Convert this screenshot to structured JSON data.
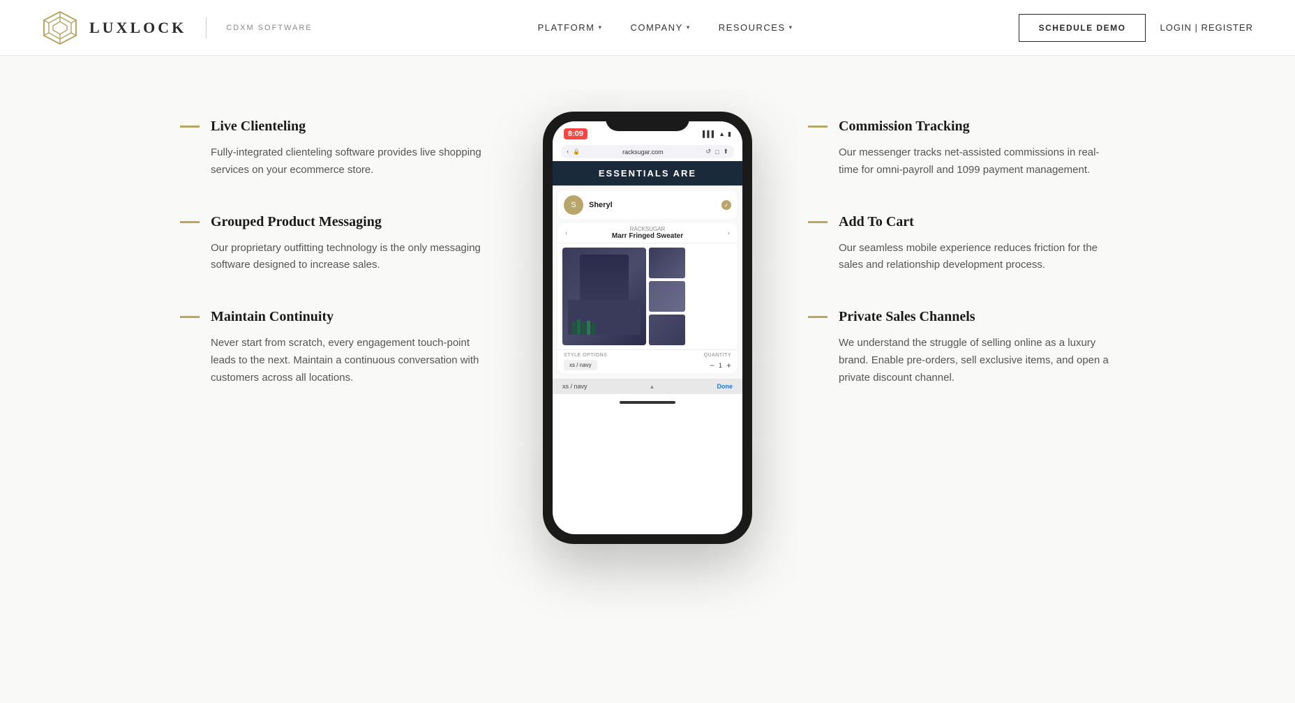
{
  "header": {
    "logo_text": "LUXLOCK",
    "logo_sub": "CDXM SOFTWARE",
    "nav": [
      {
        "label": "PLATFORM",
        "has_dropdown": true
      },
      {
        "label": "COMPANY",
        "has_dropdown": true
      },
      {
        "label": "RESOURCES",
        "has_dropdown": true
      }
    ],
    "schedule_demo": "SCHEDULE DEMO",
    "login": "LOGIN | REGISTER"
  },
  "features_left": [
    {
      "title": "Live Clienteling",
      "desc": "Fully-integrated clienteling software provides live shopping services on your ecommerce store."
    },
    {
      "title": "Grouped Product Messaging",
      "desc": "Our proprietary outfitting technology is the only messaging software designed to increase sales."
    },
    {
      "title": "Maintain Continuity",
      "desc": "Never start from scratch, every engagement touch-point leads to the next. Maintain a continuous conversation with customers across all locations."
    }
  ],
  "features_right": [
    {
      "title": "Commission Tracking",
      "desc": "Our messenger tracks net-assisted commissions in real-time for omni-payroll and 1099 payment management."
    },
    {
      "title": "Add To Cart",
      "desc": "Our seamless mobile experience reduces friction for the sales and relationship development process."
    },
    {
      "title": "Private Sales Channels",
      "desc": "We understand the struggle of selling online as a luxury brand. Enable pre-orders, sell exclusive items, and open a private discount channel."
    }
  ],
  "phone": {
    "status_time": "8:09",
    "browser_url": "racksugar.com",
    "hero_text": "ESSENTIALS ARE",
    "chat_name": "Sheryl",
    "product_brand": "RACKSUGAR",
    "product_name": "Marr Fringed Sweater",
    "style_label": "STYLE OPTIONS",
    "qty_label": "QUANTITY",
    "style_value": "xs / navy",
    "qty_value": "1",
    "footer_option": "xs / navy",
    "done_label": "Done"
  },
  "colors": {
    "accent_gold": "#b8a56a",
    "dash_gold": "#b8a56a",
    "nav_dark": "#1a2a3a",
    "body_bg": "#f9f9f7"
  }
}
